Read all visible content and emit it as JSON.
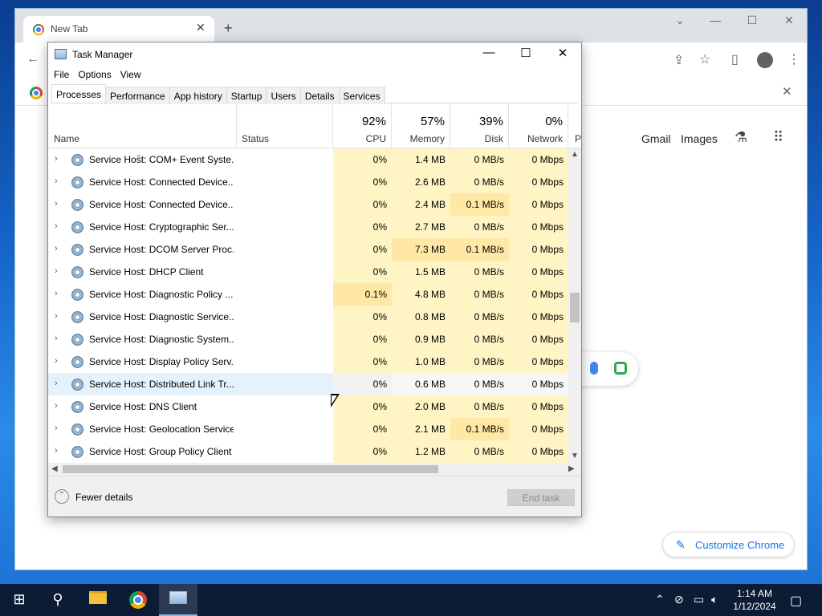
{
  "chrome": {
    "tab_title": "New Tab",
    "new_tab": "+",
    "close_tab": "✕",
    "ntp": {
      "gmail": "Gmail",
      "images": "Images",
      "customize": "Customize Chrome"
    }
  },
  "task_manager": {
    "title": "Task Manager",
    "menu": [
      "File",
      "Options",
      "View"
    ],
    "tabs": [
      "Processes",
      "Performance",
      "App history",
      "Startup",
      "Users",
      "Details",
      "Services"
    ],
    "active_tab": "Processes",
    "columns": {
      "name": "Name",
      "status": "Status",
      "cpu": {
        "pct": "92%",
        "label": "CPU"
      },
      "memory": {
        "pct": "57%",
        "label": "Memory"
      },
      "disk": {
        "pct": "39%",
        "label": "Disk"
      },
      "network": {
        "pct": "0%",
        "label": "Network"
      },
      "partial": "P"
    },
    "rows": [
      {
        "name": "Service Host: COM+ Event Syste...",
        "cpu": "0%",
        "memory": "1.4 MB",
        "disk": "0 MB/s",
        "network": "0 Mbps"
      },
      {
        "name": "Service Host: Connected Device...",
        "cpu": "0%",
        "memory": "2.6 MB",
        "disk": "0 MB/s",
        "network": "0 Mbps"
      },
      {
        "name": "Service Host: Connected Device...",
        "cpu": "0%",
        "memory": "2.4 MB",
        "disk": "0.1 MB/s",
        "network": "0 Mbps"
      },
      {
        "name": "Service Host: Cryptographic Ser...",
        "cpu": "0%",
        "memory": "2.7 MB",
        "disk": "0 MB/s",
        "network": "0 Mbps"
      },
      {
        "name": "Service Host: DCOM Server Proc...",
        "cpu": "0%",
        "memory": "7.3 MB",
        "disk": "0.1 MB/s",
        "network": "0 Mbps"
      },
      {
        "name": "Service Host: DHCP Client",
        "cpu": "0%",
        "memory": "1.5 MB",
        "disk": "0 MB/s",
        "network": "0 Mbps"
      },
      {
        "name": "Service Host: Diagnostic Policy ...",
        "cpu": "0.1%",
        "memory": "4.8 MB",
        "disk": "0 MB/s",
        "network": "0 Mbps"
      },
      {
        "name": "Service Host: Diagnostic Service...",
        "cpu": "0%",
        "memory": "0.8 MB",
        "disk": "0 MB/s",
        "network": "0 Mbps"
      },
      {
        "name": "Service Host: Diagnostic System...",
        "cpu": "0%",
        "memory": "0.9 MB",
        "disk": "0 MB/s",
        "network": "0 Mbps"
      },
      {
        "name": "Service Host: Display Policy Serv...",
        "cpu": "0%",
        "memory": "1.0 MB",
        "disk": "0 MB/s",
        "network": "0 Mbps"
      },
      {
        "name": "Service Host: Distributed Link Tr...",
        "cpu": "0%",
        "memory": "0.6 MB",
        "disk": "0 MB/s",
        "network": "0 Mbps",
        "selected": true
      },
      {
        "name": "Service Host: DNS Client",
        "cpu": "0%",
        "memory": "2.0 MB",
        "disk": "0 MB/s",
        "network": "0 Mbps"
      },
      {
        "name": "Service Host: Geolocation Service",
        "cpu": "0%",
        "memory": "2.1 MB",
        "disk": "0.1 MB/s",
        "network": "0 Mbps"
      },
      {
        "name": "Service Host: Group Policy Client",
        "cpu": "0%",
        "memory": "1.2 MB",
        "disk": "0 MB/s",
        "network": "0 Mbps"
      }
    ],
    "footer": {
      "fewer_details": "Fewer details",
      "end_task": "End task"
    }
  },
  "taskbar": {
    "time": "1:14 AM",
    "date": "1/12/2024"
  },
  "colors": {
    "cpu_cell": "#fff4c4",
    "cpu_cell_hot": "#ffecab",
    "cell": "#fff4c4",
    "cell_hot": "#ffe8a6",
    "selected_row": "#e5f1fb"
  }
}
